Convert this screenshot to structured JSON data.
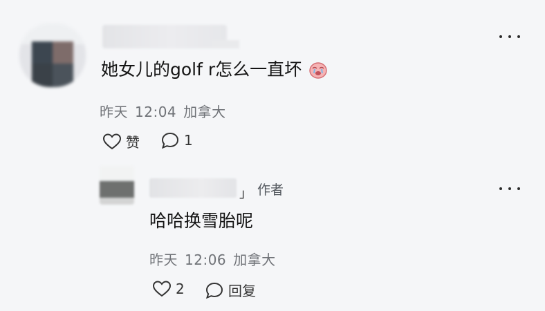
{
  "comment": {
    "text": "她女儿的golf r怎么一直坏",
    "emoji_icon": "crying-face-emoji-icon",
    "meta": {
      "date": "昨天",
      "time": "12:04",
      "location": "加拿大"
    },
    "actions": {
      "like_label": "赞",
      "reply_count": "1"
    }
  },
  "reply": {
    "author_suffix": "」",
    "author_badge": "作者",
    "text": "哈哈换雪胎呢",
    "meta": {
      "date": "昨天",
      "time": "12:06",
      "location": "加拿大"
    },
    "actions": {
      "like_count": "2",
      "reply_label": "回复"
    }
  },
  "colors": {
    "background": "#f5f6f8",
    "text": "#141414",
    "meta": "#6f7277",
    "emoji": "#f3a4a6"
  }
}
